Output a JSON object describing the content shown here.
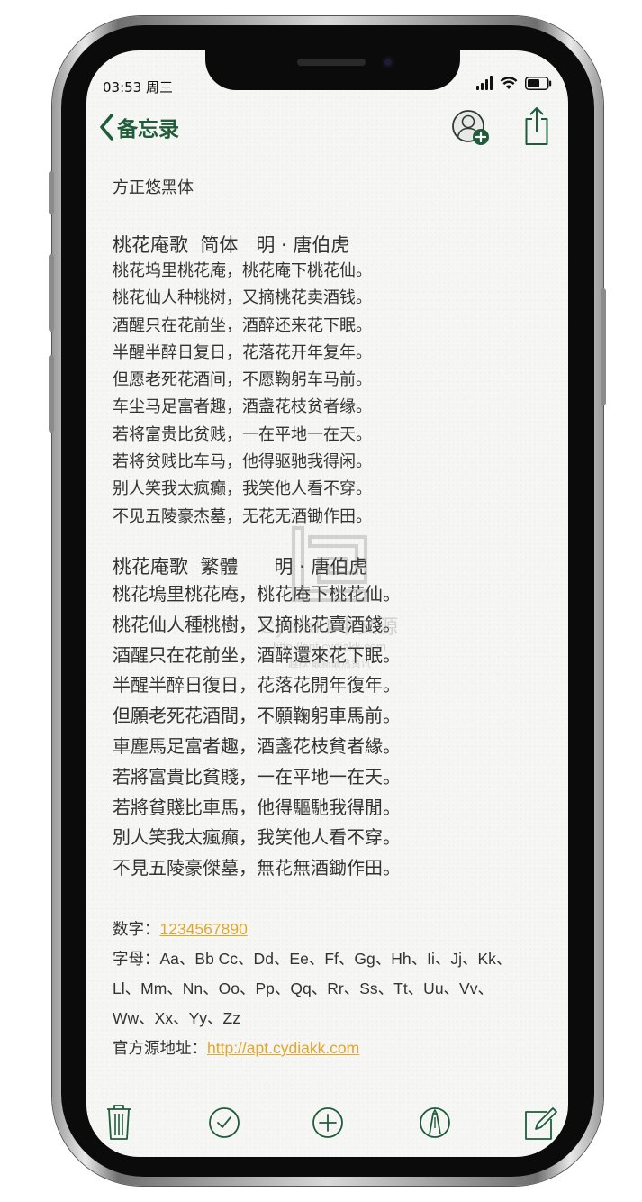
{
  "status_bar": {
    "time": "03:53 周三"
  },
  "nav": {
    "back_label": "备忘录"
  },
  "note": {
    "font_name": "方正悠黑体",
    "poem_simplified": {
      "title": "桃花庵歌  简体   明 · 唐伯虎",
      "lines": [
        "桃花坞里桃花庵，桃花庵下桃花仙。",
        "桃花仙人种桃树，又摘桃花卖酒钱。",
        "酒醒只在花前坐，酒醉还来花下眠。",
        "半醒半醉日复日，花落花开年复年。",
        "但愿老死花酒间，不愿鞠躬车马前。",
        "车尘马足富者趣，酒盏花枝贫者缘。",
        "若将富贵比贫贱，一在平地一在天。",
        "若将贫贱比车马，他得驱驰我得闲。",
        "别人笑我太疯癫，我笑他人看不穿。",
        "不见五陵豪杰墓，无花无酒锄作田。"
      ]
    },
    "poem_traditional": {
      "title": "桃花庵歌  繁體      明 · 唐伯虎",
      "lines": [
        "桃花塢里桃花庵，桃花庵下桃花仙。",
        "桃花仙人種桃樹，又摘桃花賣酒錢。",
        "酒醒只在花前坐，酒醉還來花下眠。",
        "半醒半醉日復日，花落花開年復年。",
        "但願老死花酒間，不願鞠躬車馬前。",
        "車塵馬足富者趣，酒盞花枝貧者緣。",
        "若將富貴比貧賤，一在平地一在天。",
        "若將貧賤比車馬，他得驅馳我得閒。",
        "別人笑我太瘋癲，我笑他人看不穿。",
        "不見五陵豪傑墓，無花無酒鋤作田。"
      ]
    },
    "digits_label": "数字：",
    "digits_value": "1234567890",
    "letters_label": "字母：",
    "letters_line1": "Aa、Bb Cc、Dd、Ee、Ff、Gg、Hh、Ii、Jj、Kk、",
    "letters_line2": "Ll、Mm、Nn、Oo、Pp、Qq、Rr、Ss、Tt、Uu、Vv、",
    "letters_line3": "Ww、Xx、Yy、Zz",
    "source_label": "官方源地址：",
    "source_url": "http://apt.cydiakk.com"
  },
  "watermark": {
    "main": "Cydiakk中文源",
    "url": "http://apt.cydiakk.com",
    "slogan": "越狱·最新最热资讯"
  },
  "colors": {
    "accent_green": "#1f5d3a",
    "link_yellow": "#e1a72a"
  },
  "icons": {
    "toolbar": [
      "trash-icon",
      "checklist-icon",
      "add-icon",
      "markup-icon",
      "compose-icon"
    ]
  }
}
